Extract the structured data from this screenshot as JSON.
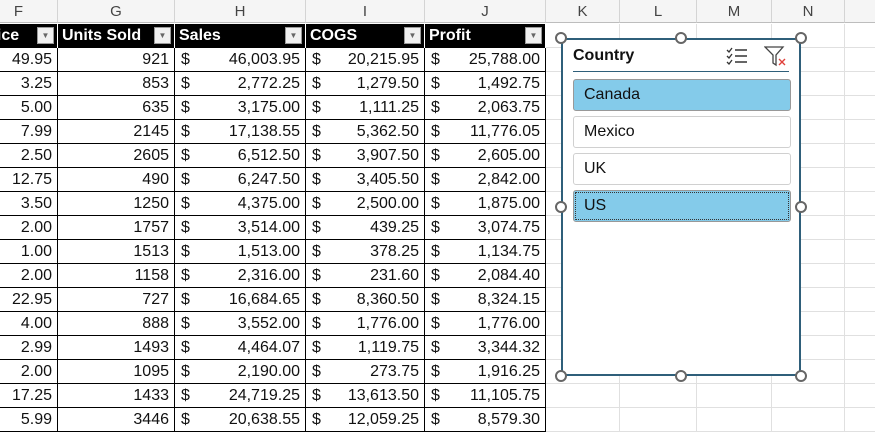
{
  "columns": [
    "F",
    "G",
    "H",
    "I",
    "J",
    "K",
    "L",
    "M",
    "N"
  ],
  "table": {
    "headers": [
      "Price",
      "Units Sold",
      "Sales",
      "COGS",
      "Profit"
    ],
    "currency_symbol": "$",
    "rows": [
      [
        "49.95",
        "921",
        "46,003.95",
        "20,215.95",
        "25,788.00"
      ],
      [
        "3.25",
        "853",
        "2,772.25",
        "1,279.50",
        "1,492.75"
      ],
      [
        "5.00",
        "635",
        "3,175.00",
        "1,111.25",
        "2,063.75"
      ],
      [
        "7.99",
        "2145",
        "17,138.55",
        "5,362.50",
        "11,776.05"
      ],
      [
        "2.50",
        "2605",
        "6,512.50",
        "3,907.50",
        "2,605.00"
      ],
      [
        "12.75",
        "490",
        "6,247.50",
        "3,405.50",
        "2,842.00"
      ],
      [
        "3.50",
        "1250",
        "4,375.00",
        "2,500.00",
        "1,875.00"
      ],
      [
        "2.00",
        "1757",
        "3,514.00",
        "439.25",
        "3,074.75"
      ],
      [
        "1.00",
        "1513",
        "1,513.00",
        "378.25",
        "1,134.75"
      ],
      [
        "2.00",
        "1158",
        "2,316.00",
        "231.60",
        "2,084.40"
      ],
      [
        "22.95",
        "727",
        "16,684.65",
        "8,360.50",
        "8,324.15"
      ],
      [
        "4.00",
        "888",
        "3,552.00",
        "1,776.00",
        "1,776.00"
      ],
      [
        "2.99",
        "1493",
        "4,464.07",
        "1,119.75",
        "3,344.32"
      ],
      [
        "2.00",
        "1095",
        "2,190.00",
        "273.75",
        "1,916.25"
      ],
      [
        "17.25",
        "1433",
        "24,719.25",
        "13,613.50",
        "11,105.75"
      ],
      [
        "5.99",
        "3446",
        "20,638.55",
        "12,059.25",
        "8,579.30"
      ]
    ]
  },
  "slicer": {
    "title": "Country",
    "items": [
      {
        "label": "Canada",
        "selected": true
      },
      {
        "label": "Mexico",
        "selected": false
      },
      {
        "label": "UK",
        "selected": false
      },
      {
        "label": "US",
        "selected": true
      }
    ]
  }
}
